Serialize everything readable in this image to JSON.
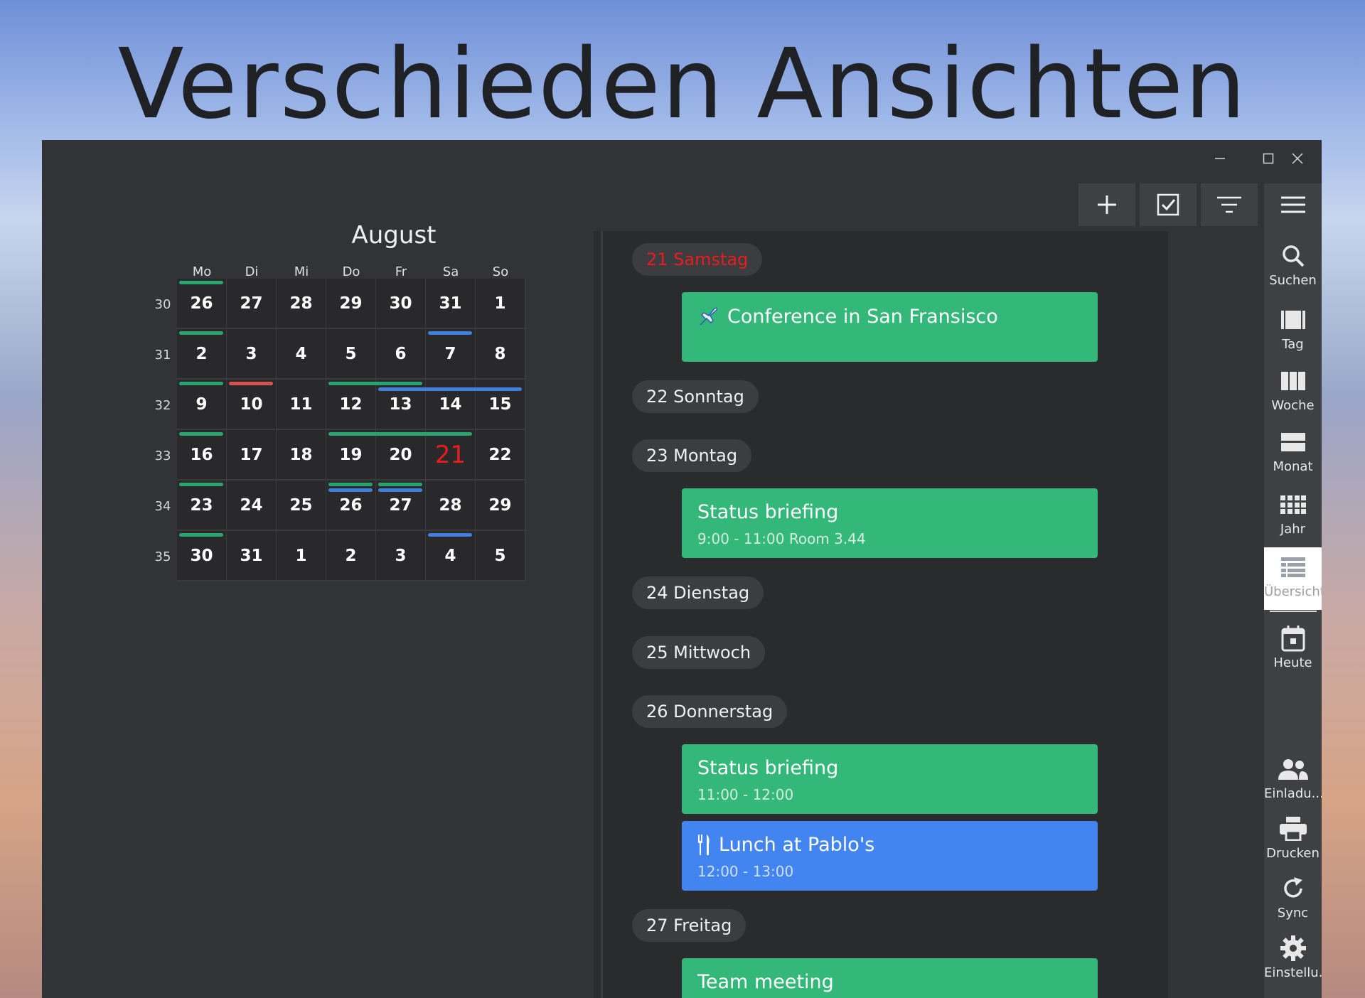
{
  "headline": "Verschieden Ansichten",
  "window_controls": {
    "minimize": "—",
    "maximize": "☐",
    "close": "✕"
  },
  "toolbar": [
    {
      "name": "add-icon"
    },
    {
      "name": "task-checkbox-icon"
    },
    {
      "name": "filter-icon"
    },
    {
      "name": "menu-icon"
    }
  ],
  "sidebar": {
    "items": [
      {
        "label": "Suchen",
        "icon": "search-icon"
      },
      {
        "label": "Tag",
        "icon": "day-view-icon"
      },
      {
        "label": "Woche",
        "icon": "week-view-icon"
      },
      {
        "label": "Monat",
        "icon": "month-view-icon"
      },
      {
        "label": "Jahr",
        "icon": "year-view-icon"
      },
      {
        "label": "Übersicht",
        "icon": "overview-icon",
        "active": true
      },
      {
        "label": "Heute",
        "icon": "today-calendar-icon"
      },
      {
        "label": "Einladu...",
        "icon": "invitations-icon"
      },
      {
        "label": "Drucken",
        "icon": "print-icon"
      },
      {
        "label": "Sync",
        "icon": "sync-icon"
      },
      {
        "label": "Einstellu...",
        "icon": "settings-gear-icon"
      }
    ]
  },
  "calendar": {
    "month": "August",
    "weekdays": [
      "Mo",
      "Di",
      "Mi",
      "Do",
      "Fr",
      "Sa",
      "So"
    ],
    "weeks": [
      {
        "num": "30",
        "days": [
          "26",
          "27",
          "28",
          "29",
          "30",
          "31",
          "1"
        ]
      },
      {
        "num": "31",
        "days": [
          "2",
          "3",
          "4",
          "5",
          "6",
          "7",
          "8"
        ]
      },
      {
        "num": "32",
        "days": [
          "9",
          "10",
          "11",
          "12",
          "13",
          "14",
          "15"
        ]
      },
      {
        "num": "33",
        "days": [
          "16",
          "17",
          "18",
          "19",
          "20",
          "21",
          "22"
        ]
      },
      {
        "num": "34",
        "days": [
          "23",
          "24",
          "25",
          "26",
          "27",
          "28",
          "29"
        ]
      },
      {
        "num": "35",
        "days": [
          "30",
          "31",
          "1",
          "2",
          "3",
          "4",
          "5"
        ]
      }
    ],
    "today": {
      "week": 3,
      "day": 5
    },
    "colors": {
      "green": "#2aa56f",
      "blue": "#3f7fe0",
      "red": "#d9534f"
    }
  },
  "agenda": {
    "days": [
      {
        "label": "21 Samstag",
        "highlight": true
      },
      {
        "label": "22 Sonntag"
      },
      {
        "label": "23 Montag"
      },
      {
        "label": "24 Dienstag"
      },
      {
        "label": "25 Mittwoch"
      },
      {
        "label": "26 Donnerstag"
      },
      {
        "label": "27 Freitag"
      }
    ],
    "events": [
      {
        "title": "Conference in San Fransisco",
        "sub": "",
        "color": "green",
        "icon": "airplane-icon"
      },
      {
        "title": "Status briefing",
        "sub": "9:00 - 11:00 Room 3.44",
        "color": "green"
      },
      {
        "title": "Status briefing",
        "sub": "11:00 - 12:00",
        "color": "green"
      },
      {
        "title": "Lunch at Pablo's",
        "sub": "12:00 - 13:00",
        "color": "blue",
        "icon": "fork-knife-icon"
      },
      {
        "title": "Team meeting",
        "sub": "",
        "color": "green"
      }
    ]
  }
}
